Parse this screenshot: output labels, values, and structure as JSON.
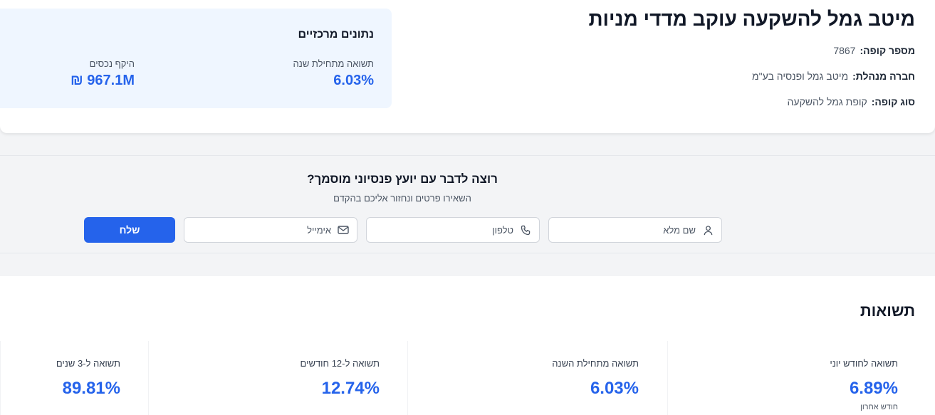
{
  "header": {
    "title": "מיטב גמל להשקעה עוקב מדדי מניות",
    "fund_number_label": "מספר קופה:",
    "fund_number": "7867",
    "managing_company_label": "חברה מנהלת:",
    "managing_company": "מיטב גמל ופנסיה בע\"מ",
    "fund_type_label": "סוג קופה:",
    "fund_type": "קופת גמל להשקעה"
  },
  "key_data": {
    "title": "נתונים מרכזיים",
    "ytd_label": "תשואה מתחילת שנה",
    "ytd_value": "6.03%",
    "assets_label": "היקף נכסים",
    "assets_value": "967.1M ₪"
  },
  "contact": {
    "title": "רוצה לדבר עם יועץ פנסיוני מוסמך?",
    "subtitle": "השאירו פרטים ונחזור אליכם בהקדם",
    "name_placeholder": "שם מלא",
    "phone_placeholder": "טלפון",
    "email_placeholder": "אימייל",
    "submit_label": "שלח",
    "button_color": "#2563eb"
  },
  "returns": {
    "title": "תשואות",
    "cards": [
      {
        "label": "תשואה לחודש יוני",
        "value": "6.89%",
        "note": "חודש אחרון"
      },
      {
        "label": "תשואה מתחילת השנה",
        "value": "6.03%"
      },
      {
        "label": "תשואה ל-12 חודשים",
        "value": "12.74%"
      },
      {
        "label": "תשואה ל-3 שנים",
        "value": "89.81%"
      }
    ],
    "accent_color": "#2563eb"
  }
}
